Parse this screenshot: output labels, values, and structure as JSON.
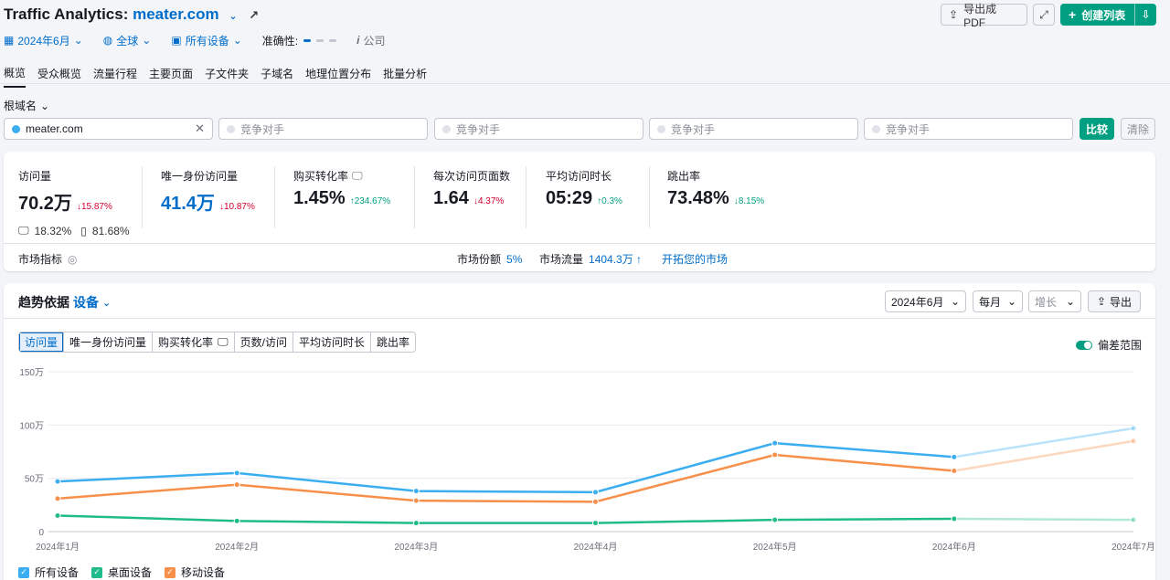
{
  "header": {
    "title_prefix": "Traffic Analytics: ",
    "domain": "meater.com",
    "export_pdf": "导出成 PDF",
    "create_list": "创建列表"
  },
  "filters": {
    "date": "2024年6月",
    "region": "全球",
    "device": "所有设备",
    "accuracy_label": "准确性:",
    "company": "公司"
  },
  "tabs": [
    "概览",
    "受众概览",
    "流量行程",
    "主要页面",
    "子文件夹",
    "子域名",
    "地理位置分布",
    "批量分析"
  ],
  "root_domain_label": "根域名",
  "competitors": {
    "main_value": "meater.com",
    "placeholder": "竞争对手",
    "compare": "比较",
    "clear": "清除"
  },
  "metrics": [
    {
      "label": "访问量",
      "value": "70.2万",
      "change": "↓15.87%",
      "dir": "down"
    },
    {
      "label": "唯一身份访问量",
      "value": "41.4万",
      "change": "↓10.87%",
      "dir": "down"
    },
    {
      "label": "购买转化率",
      "value": "1.45%",
      "change": "↑234.67%",
      "dir": "up"
    },
    {
      "label": "每次访问页面数",
      "value": "1.64",
      "change": "↓4.37%",
      "dir": "down"
    },
    {
      "label": "平均访问时长",
      "value": "05:29",
      "change": "↑0.3%",
      "dir": "up"
    },
    {
      "label": "跳出率",
      "value": "73.48%",
      "change": "↓8.15%",
      "dir": "up"
    }
  ],
  "device_split": {
    "desktop": "18.32%",
    "mobile": "81.68%"
  },
  "market": {
    "label": "市场指标",
    "share_label": "市场份额",
    "share_value": "5%",
    "traffic_label": "市场流量",
    "traffic_value": "1404.3万 ↑",
    "explore": "开拓您的市场"
  },
  "trend": {
    "title": "趋势依据",
    "by": "设备",
    "date_select": "2024年6月",
    "period_select": "每月",
    "growth_select": "增长",
    "export": "导出",
    "error_range": "偏差范围",
    "metric_tabs": [
      "访问量",
      "唯一身份访问量",
      "购买转化率",
      "页数/访问",
      "平均访问时长",
      "跳出率"
    ]
  },
  "colors": {
    "all": "#3aaef0",
    "desktop": "#1fbb8a",
    "mobile": "#f7904a",
    "accent": "#006dca",
    "brand": "#009f81"
  },
  "chart_data": {
    "type": "line",
    "x": [
      "2024年1月",
      "2024年2月",
      "2024年3月",
      "2024年4月",
      "2024年5月",
      "2024年6月",
      "2024年7月"
    ],
    "y_ticks": [
      "0",
      "50万",
      "100万",
      "150万"
    ],
    "ylim": [
      0,
      150
    ],
    "grid": true,
    "legend_position": "bottom-left",
    "series": [
      {
        "name": "所有设备",
        "values": [
          47,
          55,
          38,
          37,
          83,
          70,
          97
        ]
      },
      {
        "name": "桌面设备",
        "values": [
          15,
          10,
          8,
          8,
          11,
          12,
          11
        ]
      },
      {
        "name": "移动设备",
        "values": [
          31,
          44,
          29,
          28,
          72,
          57,
          85
        ]
      }
    ],
    "forecast_from_index": 5
  }
}
